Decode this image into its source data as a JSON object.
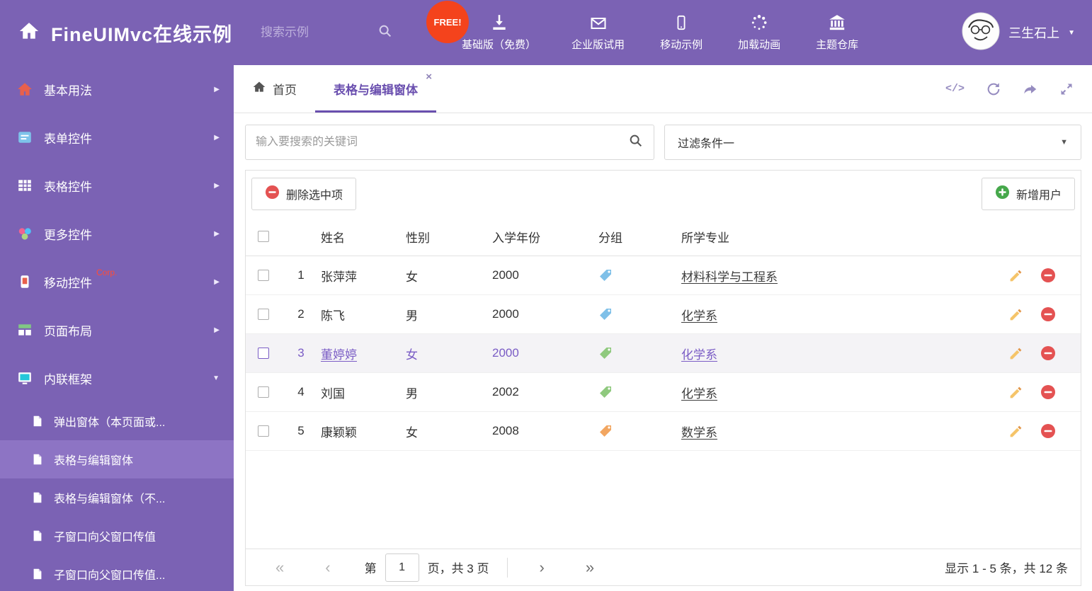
{
  "colors": {
    "purple_header": "#7b62b4",
    "purple_sidebar_active": "#8d74c4",
    "accent_tab": "#6a4faf",
    "free_badge_bg": "#f4431c",
    "danger_red": "#e45252",
    "success_green": "#46a84b",
    "pencil_orange": "#f5c469",
    "selected_row_text": "#7a5cc5"
  },
  "header": {
    "title": "FineUIMvc在线示例",
    "search_placeholder": "搜索示例",
    "free_badge": "FREE!",
    "nav": [
      {
        "label": "基础版（免费）",
        "icon": "download-icon"
      },
      {
        "label": "企业版试用",
        "icon": "envelope-icon"
      },
      {
        "label": "移动示例",
        "icon": "mobile-icon"
      },
      {
        "label": "加载动画",
        "icon": "spinner-icon"
      },
      {
        "label": "主题仓库",
        "icon": "bank-icon"
      }
    ],
    "user_name": "三生石上"
  },
  "sidebar": {
    "items": [
      {
        "label": "基本用法",
        "icon": "home-icon"
      },
      {
        "label": "表单控件",
        "icon": "form-icon"
      },
      {
        "label": "表格控件",
        "icon": "table-icon"
      },
      {
        "label": "更多控件",
        "icon": "widgets-icon"
      },
      {
        "label": "移动控件",
        "badge": "Corp.",
        "icon": "mobile-icon"
      },
      {
        "label": "页面布局",
        "icon": "layout-icon"
      },
      {
        "label": "内联框架",
        "icon": "frame-icon"
      }
    ],
    "subitems": [
      {
        "label": "弹出窗体（本页面或..."
      },
      {
        "label": "表格与编辑窗体",
        "active": true
      },
      {
        "label": "表格与编辑窗体（不..."
      },
      {
        "label": "子窗口向父窗口传值"
      },
      {
        "label": "子窗口向父窗口传值..."
      }
    ]
  },
  "tabs": [
    {
      "label": "首页",
      "icon": "home-icon"
    },
    {
      "label": "表格与编辑窗体",
      "active": true,
      "closable": true
    }
  ],
  "tab_tools": [
    "code-icon",
    "refresh-icon",
    "forward-icon",
    "expand-icon"
  ],
  "filter_bar": {
    "search_placeholder": "输入要搜索的关键词",
    "filter_value": "过滤条件一"
  },
  "grid": {
    "delete_button": "删除选中项",
    "add_button": "新增用户",
    "columns": [
      "姓名",
      "性别",
      "入学年份",
      "分组",
      "所学专业"
    ],
    "rows": [
      {
        "num": "1",
        "name": "张萍萍",
        "gender": "女",
        "year": "2000",
        "tag_color": "#7fc0e8",
        "major": "材料科学与工程系"
      },
      {
        "num": "2",
        "name": "陈飞",
        "gender": "男",
        "year": "2000",
        "tag_color": "#7fc0e8",
        "major": "化学系"
      },
      {
        "num": "3",
        "name": "董婷婷",
        "gender": "女",
        "year": "2000",
        "tag_color": "#8fc97e",
        "major": "化学系",
        "selected": true
      },
      {
        "num": "4",
        "name": "刘国",
        "gender": "男",
        "year": "2002",
        "tag_color": "#8fc97e",
        "major": "化学系"
      },
      {
        "num": "5",
        "name": "康颖颖",
        "gender": "女",
        "year": "2008",
        "tag_color": "#f2a661",
        "major": "数学系"
      }
    ]
  },
  "pagination": {
    "first": "«",
    "prev": "‹",
    "next": "›",
    "last": "»",
    "prefix": "第",
    "page": "1",
    "suffix": "页，共 3 页",
    "summary": "显示 1 - 5 条，共 12 条"
  }
}
